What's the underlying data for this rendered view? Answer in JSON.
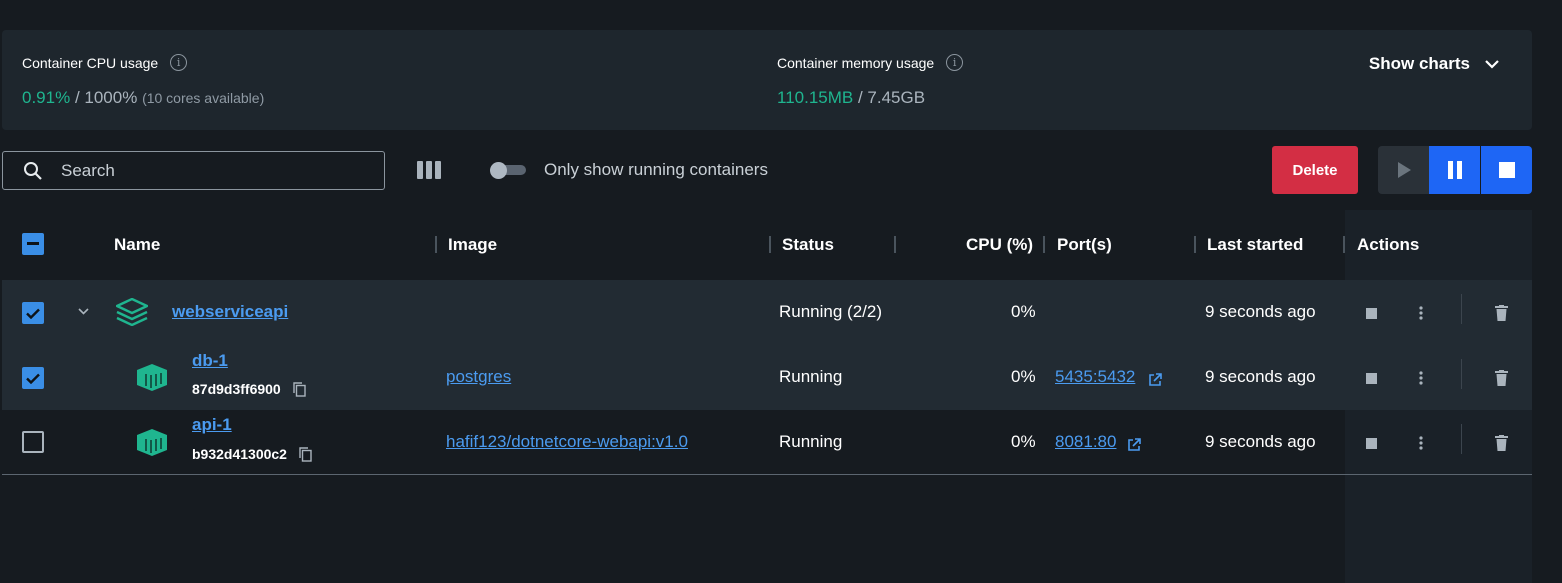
{
  "stats": {
    "cpu_title": "Container CPU usage",
    "cpu_value": "0.91%",
    "cpu_total": "/ 1000%",
    "cpu_cores": "(10 cores available)",
    "mem_title": "Container memory usage",
    "mem_value": "110.15MB",
    "mem_total": "/ 7.45GB",
    "show_charts": "Show charts"
  },
  "toolbar": {
    "search_placeholder": "Search",
    "toggle_label": "Only show running containers",
    "delete_label": "Delete"
  },
  "table": {
    "headers": {
      "name": "Name",
      "image": "Image",
      "status": "Status",
      "cpu": "CPU (%)",
      "ports": "Port(s)",
      "last_started": "Last started",
      "actions": "Actions"
    },
    "group": {
      "name": "webserviceapi",
      "status": "Running (2/2)",
      "cpu": "0%",
      "last_started": "9 seconds ago",
      "checked": true
    },
    "rows": [
      {
        "name": "db-1",
        "id": "87d9d3ff6900",
        "image": "postgres",
        "status": "Running",
        "cpu": "0%",
        "port": "5435:5432",
        "last_started": "9 seconds ago",
        "checked": true
      },
      {
        "name": "api-1",
        "id": "b932d41300c2",
        "image": "hafif123/dotnetcore-webapi:v1.0",
        "status": "Running",
        "cpu": "0%",
        "port": "8081:80",
        "last_started": "9 seconds ago",
        "checked": false
      }
    ]
  },
  "colors": {
    "accent_green": "#1fb58f",
    "link_blue": "#4b9bf0",
    "delete_red": "#d32e44",
    "primary_blue": "#1e66f5"
  }
}
